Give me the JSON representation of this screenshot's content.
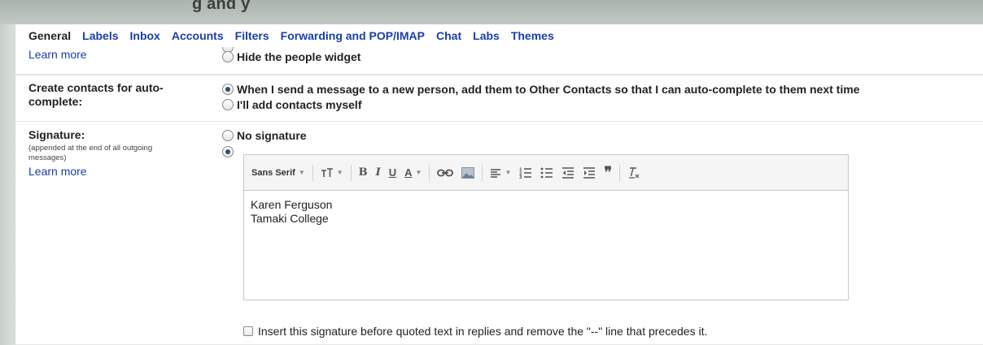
{
  "window": {
    "partial_title": "g and y"
  },
  "tabs": [
    {
      "label": "General",
      "active": true
    },
    {
      "label": "Labels",
      "active": false
    },
    {
      "label": "Inbox",
      "active": false
    },
    {
      "label": "Accounts",
      "active": false
    },
    {
      "label": "Filters",
      "active": false
    },
    {
      "label": "Forwarding and POP/IMAP",
      "active": false
    },
    {
      "label": "Chat",
      "active": false
    },
    {
      "label": "Labs",
      "active": false
    },
    {
      "label": "Themes",
      "active": false
    }
  ],
  "people_widget": {
    "learn_more": "Learn more",
    "hide_option": "Hide the people widget",
    "hide_selected": false
  },
  "auto_complete": {
    "label": "Create contacts for auto-complete:",
    "option_auto": "When I send a message to a new person, add them to Other Contacts so that I can auto-complete to them next time",
    "option_manual": "I'll add contacts myself",
    "selected": "auto"
  },
  "signature": {
    "label": "Signature:",
    "note": "(appended at the end of all outgoing messages)",
    "learn_more": "Learn more",
    "no_signature_option": "No signature",
    "selected": "custom",
    "toolbar": {
      "font": "Sans Serif",
      "icons": [
        "text-size-icon",
        "bold-icon",
        "italic-icon",
        "underline-icon",
        "text-color-icon",
        "link-icon",
        "image-icon",
        "align-icon",
        "numbered-list-icon",
        "bulleted-list-icon",
        "indent-less-icon",
        "indent-more-icon",
        "quote-icon",
        "remove-formatting-icon"
      ]
    },
    "text_line1": "Karen Ferguson",
    "text_line2": "Tamaki College",
    "insert_before_quoted": "Insert this signature before quoted text in replies and remove the \"--\" line that precedes it.",
    "insert_before_checked": false
  }
}
